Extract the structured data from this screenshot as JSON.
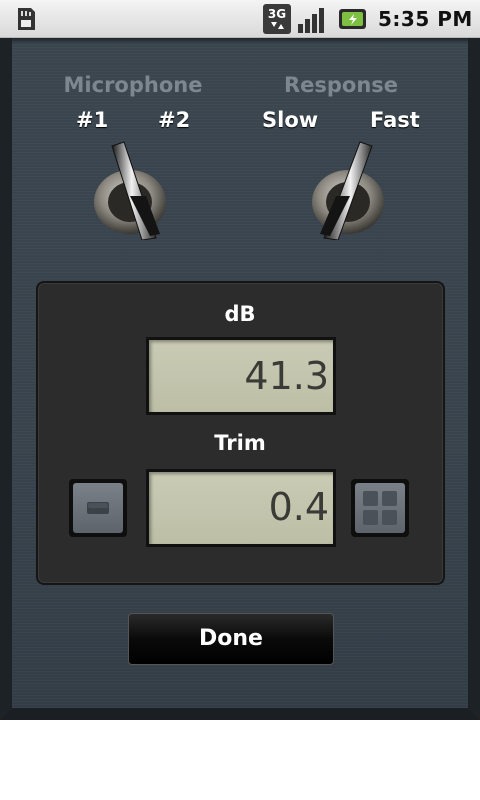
{
  "status_bar": {
    "time": "5:35 PM",
    "icons": [
      "sd-card-icon",
      "3g-data-icon",
      "signal-strength-icon",
      "battery-charging-icon"
    ],
    "network_label": "3G"
  },
  "microphone": {
    "title": "Microphone",
    "options": [
      "#1",
      "#2"
    ],
    "selected": "#1"
  },
  "response": {
    "title": "Response",
    "options": [
      "Slow",
      "Fast"
    ],
    "selected": "Fast"
  },
  "meter": {
    "db_label": "dB",
    "db_value": "41.3",
    "trim_label": "Trim",
    "trim_value": "0.4",
    "trim_minus_icon": "minus-icon",
    "trim_plus_icon": "plus-icon"
  },
  "done_label": "Done",
  "colors": {
    "panel": "#3a444e",
    "lcd": "#c4c6ae",
    "group_title": "#7d8790"
  }
}
